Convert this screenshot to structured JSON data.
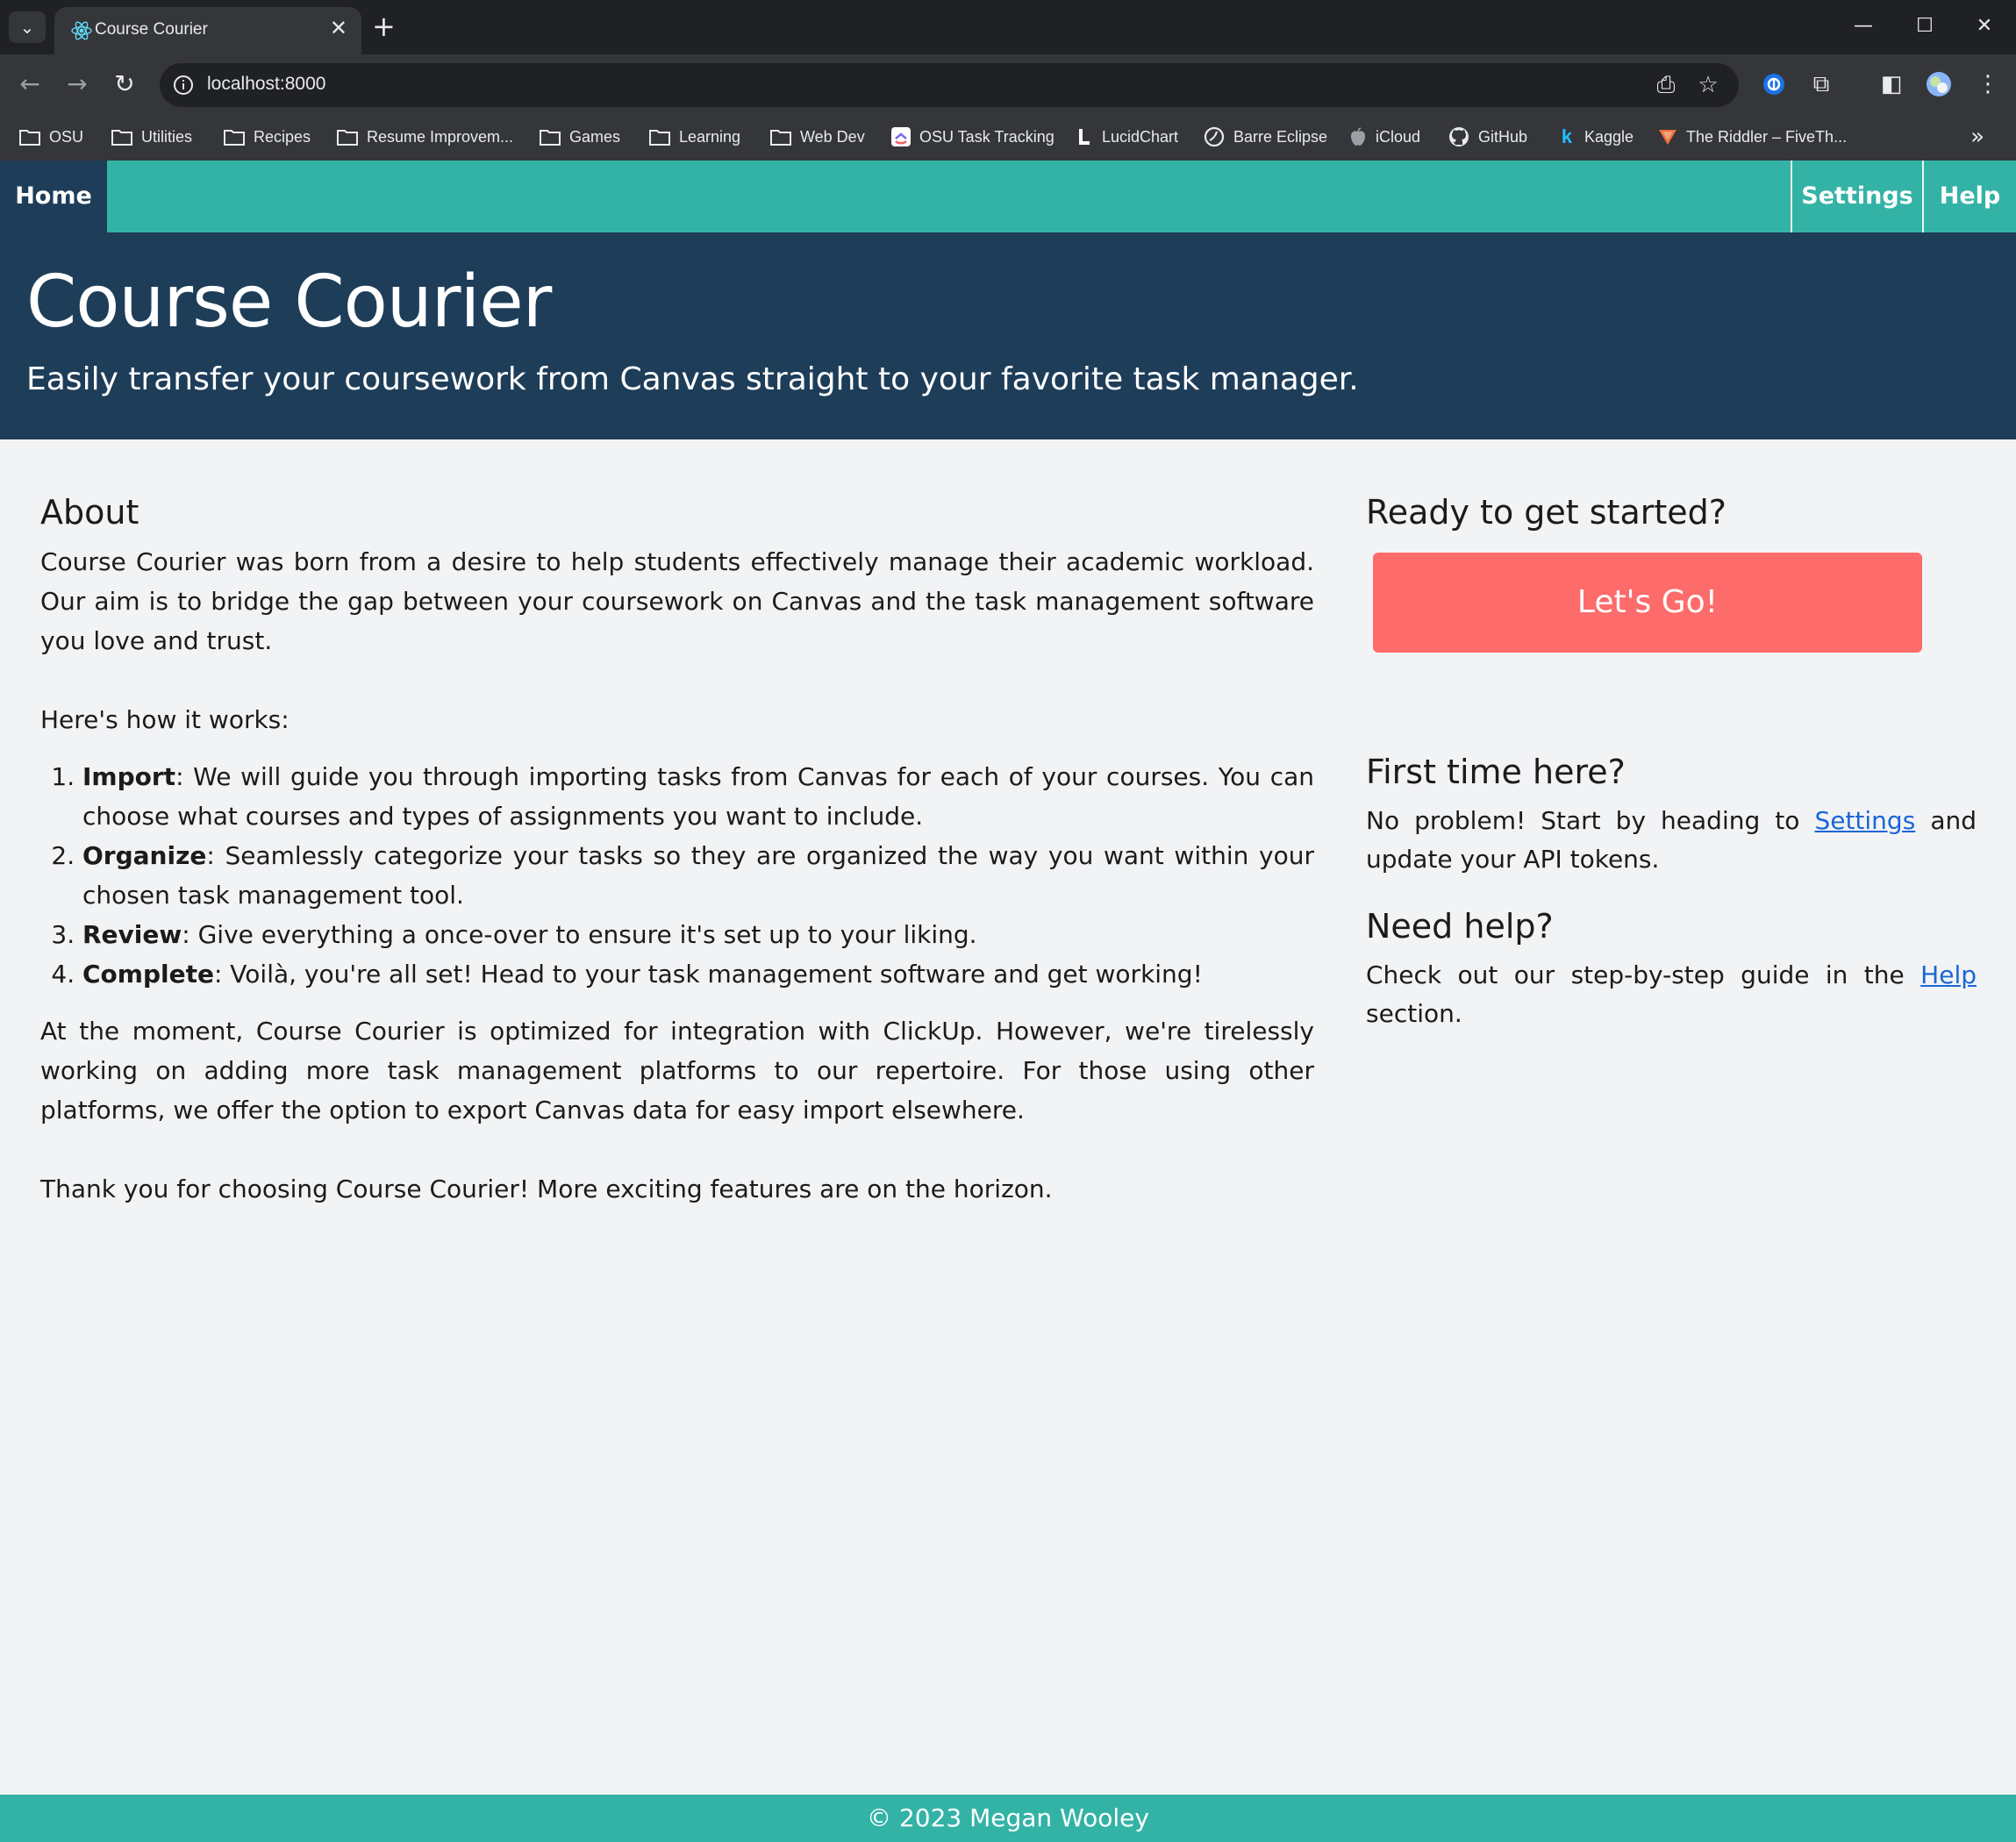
{
  "browser": {
    "tab_title": "Course Courier",
    "url": "localhost:8000",
    "bookmarks": [
      {
        "label": "OSU",
        "icon": "folder-icon"
      },
      {
        "label": "Utilities",
        "icon": "folder-icon"
      },
      {
        "label": "Recipes",
        "icon": "folder-icon"
      },
      {
        "label": "Resume Improvem...",
        "icon": "folder-icon"
      },
      {
        "label": "Games",
        "icon": "folder-icon"
      },
      {
        "label": "Learning",
        "icon": "folder-icon"
      },
      {
        "label": "Web Dev",
        "icon": "folder-icon"
      },
      {
        "label": "OSU Task Tracking",
        "icon": "clickup-icon"
      },
      {
        "label": "LucidChart",
        "icon": "lucidchart-icon"
      },
      {
        "label": "Barre Eclipse",
        "icon": "barre-icon"
      },
      {
        "label": "iCloud",
        "icon": "apple-icon"
      },
      {
        "label": "GitHub",
        "icon": "github-icon"
      },
      {
        "label": "Kaggle",
        "icon": "kaggle-icon"
      },
      {
        "label": "The Riddler – FiveTh...",
        "icon": "fivethirtyeight-icon"
      }
    ]
  },
  "nav": {
    "home": "Home",
    "settings": "Settings",
    "help": "Help"
  },
  "hero": {
    "title": "Course Courier",
    "subtitle": "Easily transfer your coursework from Canvas straight to your favorite task manager."
  },
  "about": {
    "heading": "About",
    "intro": "Course Courier was born from a desire to help students effectively manage their academic workload. Our aim is to bridge the gap between your coursework on Canvas and the task management software you love and trust.",
    "how_it_works": "Here's how it works:",
    "steps": [
      {
        "term": "Import",
        "text": ": We will guide you through importing tasks from Canvas for each of your courses. You can choose what courses and types of assignments you want to include."
      },
      {
        "term": "Organize",
        "text": ": Seamlessly categorize your tasks so they are organized the way you want within your chosen task management tool."
      },
      {
        "term": "Review",
        "text": ": Give everything a once-over to ensure it's set up to your liking."
      },
      {
        "term": "Complete",
        "text": ": Voilà, you're all set! Head to your task management software and get working!"
      }
    ],
    "integration": "At the moment, Course Courier is optimized for integration with ClickUp. However, we're tirelessly working on adding more task management platforms to our repertoire. For those using other platforms, we offer the option to export Canvas data for easy import elsewhere.",
    "thanks": "Thank you for choosing Course Courier! More exciting features are on the horizon."
  },
  "sidebar": {
    "ready_heading": "Ready to get started?",
    "cta_label": "Let's Go!",
    "first_time_heading": "First time here?",
    "first_time_before": "No problem! Start by heading to ",
    "first_time_link": "Settings",
    "first_time_after": " and update your API tokens.",
    "help_heading": "Need help?",
    "help_before": "Check out our step-by-step guide in the ",
    "help_link": "Help",
    "help_after": " section."
  },
  "footer": {
    "text": "© 2023 Megan Wooley"
  },
  "colors": {
    "teal": "#33b3a6",
    "navy": "#1e3d59",
    "cta": "#fe6b6b",
    "link": "#1a66d6"
  }
}
